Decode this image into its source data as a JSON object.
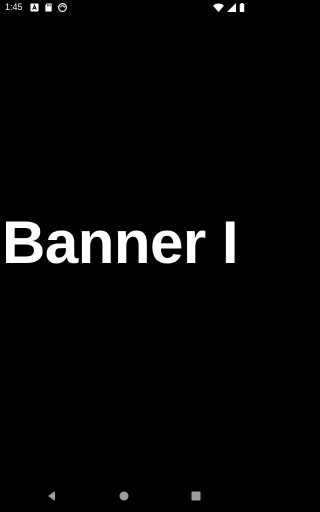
{
  "status_bar": {
    "time": "1:45",
    "left_icons": [
      "notification-a-icon",
      "sd-card-icon",
      "sync-icon"
    ],
    "right_icons": [
      "wifi-icon",
      "cell-signal-icon",
      "battery-icon"
    ]
  },
  "main": {
    "banner_text": "Banner I"
  },
  "nav_bar": {
    "buttons": [
      "back",
      "home",
      "recents"
    ]
  },
  "colors": {
    "background": "#000000",
    "foreground": "#ffffff",
    "nav_icon": "#9e9e9e"
  }
}
